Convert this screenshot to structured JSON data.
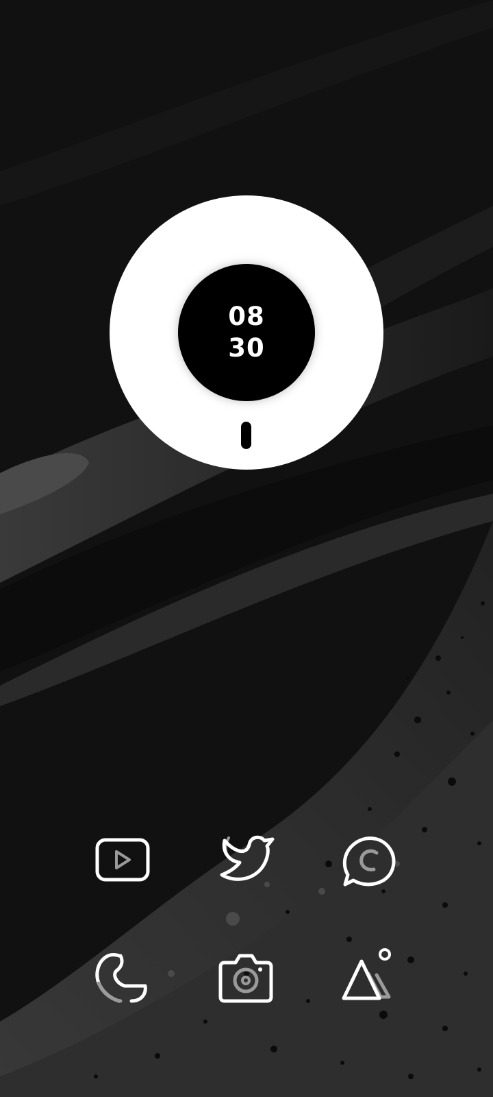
{
  "clock": {
    "hours": "08",
    "minutes": "30"
  },
  "colors": {
    "wallpaper_base": "#111111",
    "widget_outer": "#ffffff",
    "widget_inner": "#000000",
    "icon_stroke": "#ffffff",
    "icon_accent": "#9a9a9a"
  },
  "apps": [
    {
      "id": "youtube",
      "icon": "youtube-icon"
    },
    {
      "id": "twitter",
      "icon": "twitter-icon"
    },
    {
      "id": "whatsapp",
      "icon": "whatsapp-icon"
    },
    {
      "id": "phone",
      "icon": "phone-icon"
    },
    {
      "id": "camera",
      "icon": "camera-icon"
    },
    {
      "id": "gallery",
      "icon": "gallery-icon"
    }
  ]
}
